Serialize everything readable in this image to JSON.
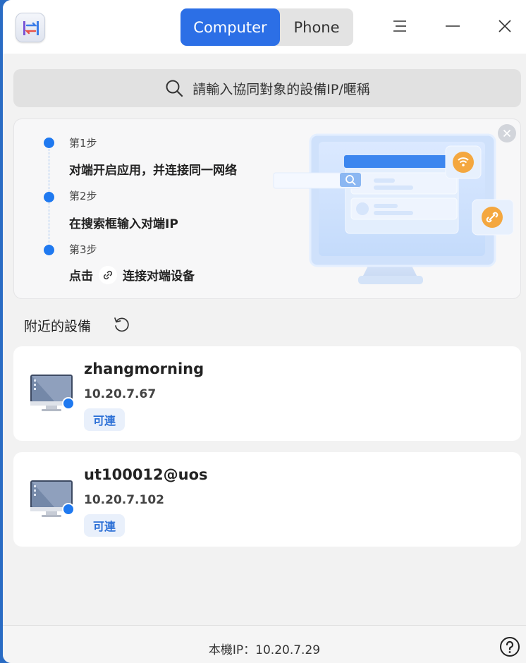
{
  "titlebar": {
    "tabs": [
      {
        "label": "Computer",
        "active": true
      },
      {
        "label": "Phone",
        "active": false
      }
    ],
    "icons": [
      "menu-icon",
      "minimize-icon",
      "close-icon"
    ]
  },
  "search": {
    "placeholder": "請輸入協同對象的設備IP/暱稱",
    "icon": "search-icon"
  },
  "guide": {
    "steps": [
      {
        "title": "第1步",
        "desc": "对端开启应用，并连接同一网络"
      },
      {
        "title": "第2步",
        "desc": "在搜索框输入对端IP"
      },
      {
        "title": "第3步",
        "desc_before": "点击",
        "desc_icon": "link-icon",
        "desc_after": "连接对端设备"
      }
    ]
  },
  "nearby": {
    "title": "附近的設備",
    "devices": [
      {
        "name": "zhangmorning",
        "ip": "10.20.7.67",
        "status": "可連"
      },
      {
        "name": "ut100012@uos",
        "ip": "10.20.7.102",
        "status": "可連"
      }
    ]
  },
  "footer": {
    "local_ip": "本機IP：10.20.7.29"
  },
  "colors": {
    "accent": "#2c6fe6",
    "step_dot": "#1f79f0",
    "badge_text": "#2b6fd6",
    "badge_bg": "#e9f0fb",
    "wifi_orange": "#f2a23c"
  }
}
